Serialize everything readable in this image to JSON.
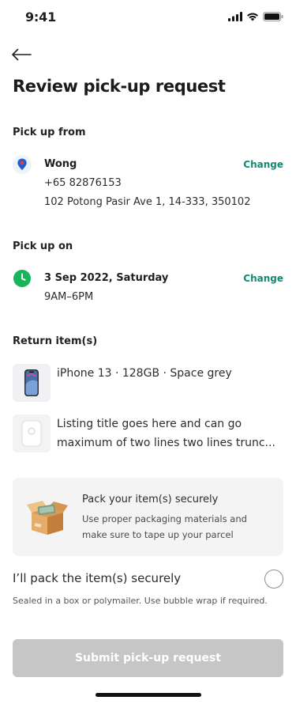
{
  "status_bar": {
    "time": "9:41"
  },
  "header": {
    "title": "Review pick-up request"
  },
  "pickup_from": {
    "label": "Pick up from",
    "name": "Wong",
    "phone": "+65 82876153",
    "address": "102 Potong Pasir Ave 1, 14-333, 350102",
    "change_label": "Change"
  },
  "pickup_on": {
    "label": "Pick up on",
    "date": "3 Sep 2022, Saturday",
    "time": "9AM–6PM",
    "change_label": "Change"
  },
  "return_items": {
    "label": "Return item(s)",
    "items": [
      {
        "title": "iPhone 13 · 128GB · Space grey"
      },
      {
        "title_line1": "Listing title goes here and can go",
        "title_line2": "maximum of two lines two lines trunc..."
      }
    ]
  },
  "packing_tip": {
    "title": "Pack your item(s) securely",
    "body": "Use proper packaging materials and make sure to tape up your parcel"
  },
  "confirm": {
    "label": "I’ll pack the item(s) securely",
    "sublabel": "Sealed in a box or polymailer. Use bubble wrap if required.",
    "checked": false
  },
  "submit": {
    "label": "Submit pick-up request",
    "enabled": false
  },
  "colors": {
    "accent": "#118a72",
    "pin": "#1a5fd6",
    "pin_dot": "#e0413a",
    "clock": "#18b35a",
    "button_disabled": "#c6c6c6"
  },
  "icons": [
    "signal-icon",
    "wifi-icon",
    "battery-icon",
    "back-arrow-icon",
    "location-pin-icon",
    "clock-icon",
    "box-icon"
  ]
}
